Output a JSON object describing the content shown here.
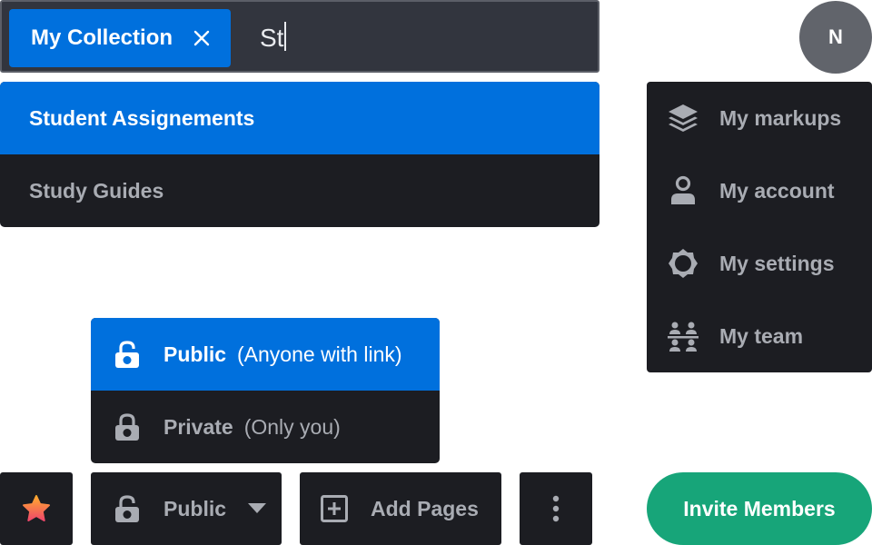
{
  "search": {
    "chip_label": "My Collection",
    "query": "St",
    "suggestions": [
      {
        "label": "Student Assignements"
      },
      {
        "label": "Study Guides"
      }
    ]
  },
  "avatar": {
    "initial": "N"
  },
  "user_menu": {
    "items": [
      {
        "label": "My markups",
        "icon": "layers-icon"
      },
      {
        "label": "My account",
        "icon": "user-icon"
      },
      {
        "label": "My settings",
        "icon": "gear-icon"
      },
      {
        "label": "My team",
        "icon": "team-icon"
      }
    ]
  },
  "visibility_menu": {
    "items": [
      {
        "name": "Public",
        "desc": "(Anyone with link)",
        "icon": "unlock-icon"
      },
      {
        "name": "Private",
        "desc": "(Only you)",
        "icon": "lock-icon"
      }
    ]
  },
  "toolbar": {
    "visibility_label": "Public",
    "add_pages_label": "Add Pages",
    "invite_label": "Invite Members"
  },
  "colors": {
    "accent": "#0070dd",
    "dark_panel": "#1c1d22",
    "search_bg": "#32353e",
    "muted_text": "#a9acb3",
    "invite": "#17a579",
    "avatar": "#61646b"
  }
}
